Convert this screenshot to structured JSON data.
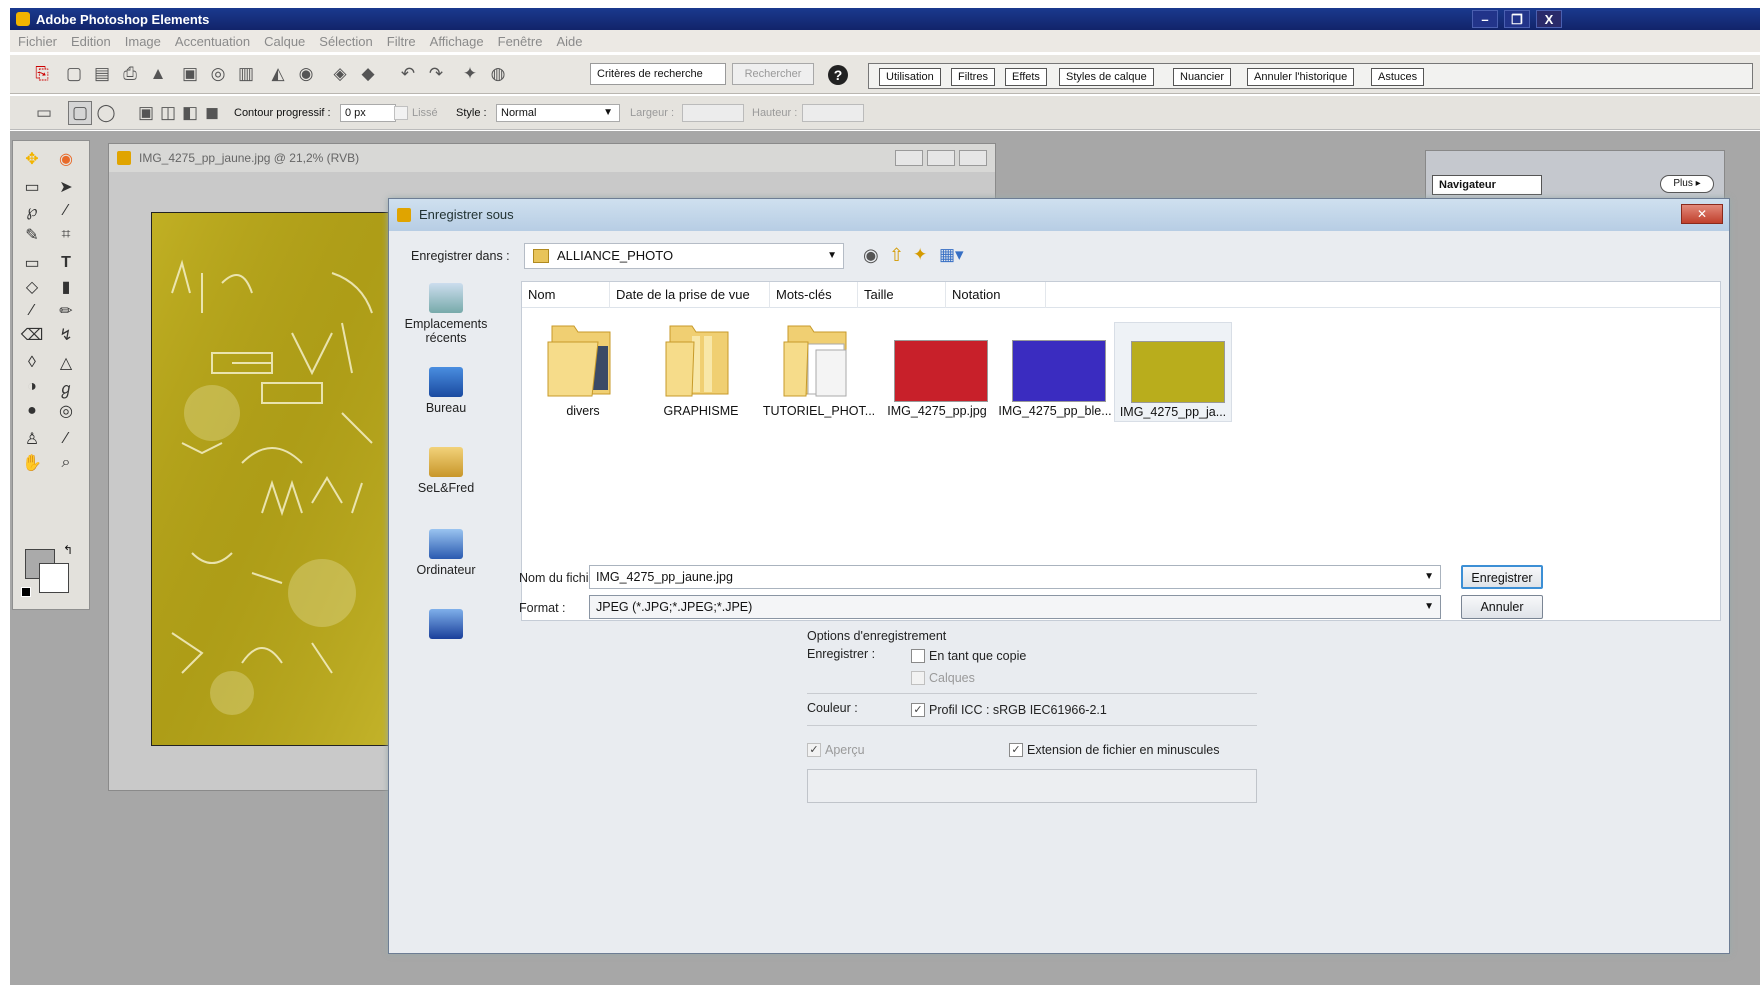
{
  "app": {
    "title": "Adobe Photoshop Elements"
  },
  "menu": [
    "Fichier",
    "Edition",
    "Image",
    "Accentuation",
    "Calque",
    "Sélection",
    "Filtre",
    "Affichage",
    "Fenêtre",
    "Aide"
  ],
  "toolbar": {
    "search_field": "Critères de recherche",
    "search_button": "Rechercher",
    "tabs": [
      "Utilisation",
      "Filtres",
      "Effets",
      "Styles de calque",
      "Nuancier",
      "Annuler l'historique",
      "Astuces"
    ]
  },
  "options_bar": {
    "feather_label": "Contour progressif :",
    "feather_value": "0 px",
    "antialias_label": "Lissé",
    "style_label": "Style :",
    "style_value": "Normal",
    "width_label": "Largeur :",
    "height_label": "Hauteur :"
  },
  "document": {
    "title": "IMG_4275_pp_jaune.jpg @ 21,2% (RVB)"
  },
  "navigator": {
    "tab": "Navigateur",
    "more_button": "Plus ▸"
  },
  "dialog": {
    "title": "Enregistrer sous",
    "save_in_label": "Enregistrer dans :",
    "current_folder": "ALLIANCE_PHOTO",
    "places": [
      "Emplacements récents",
      "Bureau",
      "SeL&Fred",
      "Ordinateur"
    ],
    "columns": [
      "Nom",
      "Date de la prise de vue",
      "Mots-clés",
      "Taille",
      "Notation"
    ],
    "files": [
      {
        "name": "divers",
        "kind": "folder"
      },
      {
        "name": "GRAPHISME",
        "kind": "folder"
      },
      {
        "name": "TUTORIEL_PHOT...",
        "kind": "folder"
      },
      {
        "name": "IMG_4275_pp.jpg",
        "kind": "image",
        "color": "#c8202a"
      },
      {
        "name": "IMG_4275_pp_ble...",
        "kind": "image",
        "color": "#3a2cc0"
      },
      {
        "name": "IMG_4275_pp_ja...",
        "kind": "image",
        "color": "#b9ad1c"
      }
    ],
    "filename_label": "Nom du fichier :",
    "filename_value": "IMG_4275_pp_jaune.jpg",
    "format_label": "Format :",
    "format_value": "JPEG (*.JPG;*.JPEG;*.JPE)",
    "save_button": "Enregistrer",
    "cancel_button": "Annuler",
    "options_title": "Options d'enregistrement",
    "save_label": "Enregistrer :",
    "as_copy": "En tant que copie",
    "as_copy_checked": false,
    "layers": "Calques",
    "color_label": "Couleur :",
    "icc_profile": "Profil ICC : sRGB IEC61966-2.1",
    "icc_checked": true,
    "preview": "Aperçu",
    "lowercase_ext": "Extension de fichier en minuscules",
    "lowercase_checked": true
  }
}
